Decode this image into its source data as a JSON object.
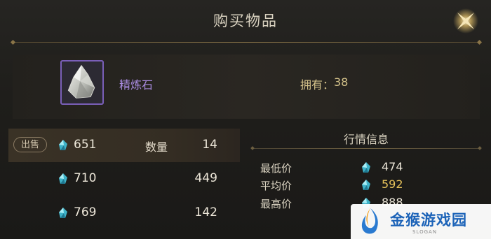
{
  "dialog": {
    "title": "购买物品"
  },
  "item": {
    "name": "精炼石",
    "owned_label": "拥有：",
    "owned_value": "38"
  },
  "sell_badge": "出售",
  "quantity_label": "数量",
  "listings": [
    {
      "price": "651",
      "count": "14"
    },
    {
      "price": "710",
      "count": "449"
    },
    {
      "price": "769",
      "count": "142"
    }
  ],
  "market": {
    "title": "行情信息",
    "stats": [
      {
        "label": "最低价",
        "value": "474"
      },
      {
        "label": "平均价",
        "value": "592"
      },
      {
        "label": "最高价",
        "value": "888"
      }
    ]
  },
  "watermark": {
    "name": "金猴游戏园",
    "slogan": "SLOGAN"
  },
  "colors": {
    "rare_item": "#a98be0",
    "gold": "#e6c25a",
    "accent": "#d4c28a"
  },
  "icons": {
    "close": "close-icon",
    "currency": "gem-icon",
    "item": "refining-stone-icon"
  }
}
